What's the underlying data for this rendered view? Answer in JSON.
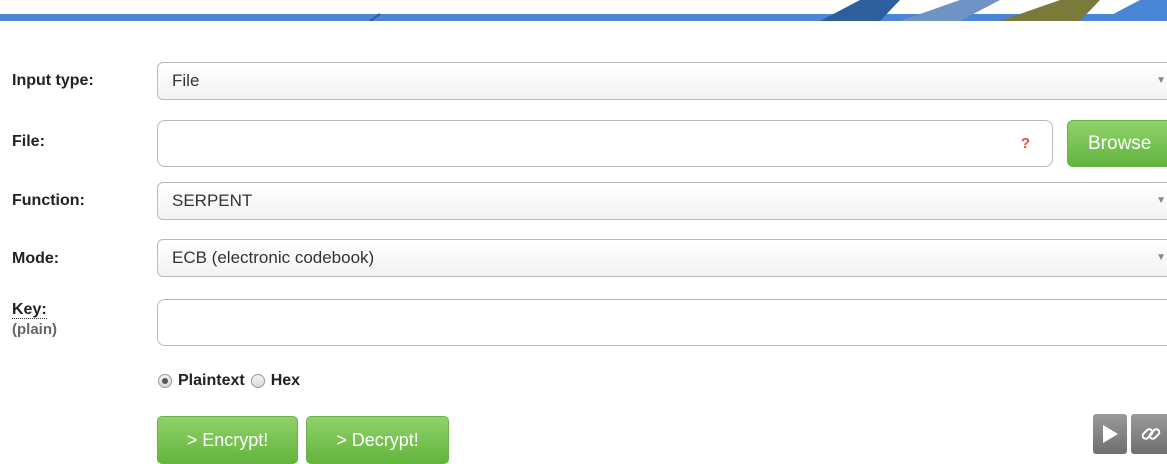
{
  "form": {
    "input_type": {
      "label": "Input type:",
      "value": "File"
    },
    "file": {
      "label": "File:",
      "value": "",
      "help": "?",
      "browse_label": "Browse"
    },
    "function": {
      "label": "Function:",
      "value": "SERPENT"
    },
    "mode": {
      "label": "Mode:",
      "value": "ECB (electronic codebook)"
    },
    "key": {
      "label": "Key:",
      "sublabel": "(plain)",
      "value": ""
    },
    "key_format": {
      "options": [
        {
          "label": "Plaintext",
          "selected": true
        },
        {
          "label": "Hex",
          "selected": false
        }
      ]
    },
    "actions": {
      "encrypt_label": "> Encrypt!",
      "decrypt_label": "> Decrypt!"
    }
  },
  "icons": {
    "dropdown": "chevron-down-icon",
    "run": "play-icon",
    "link": "link-icon"
  },
  "colors": {
    "accent_green": "#6cbe45",
    "banner_blue": "#4a86d8",
    "help_red": "#e74c3c"
  }
}
